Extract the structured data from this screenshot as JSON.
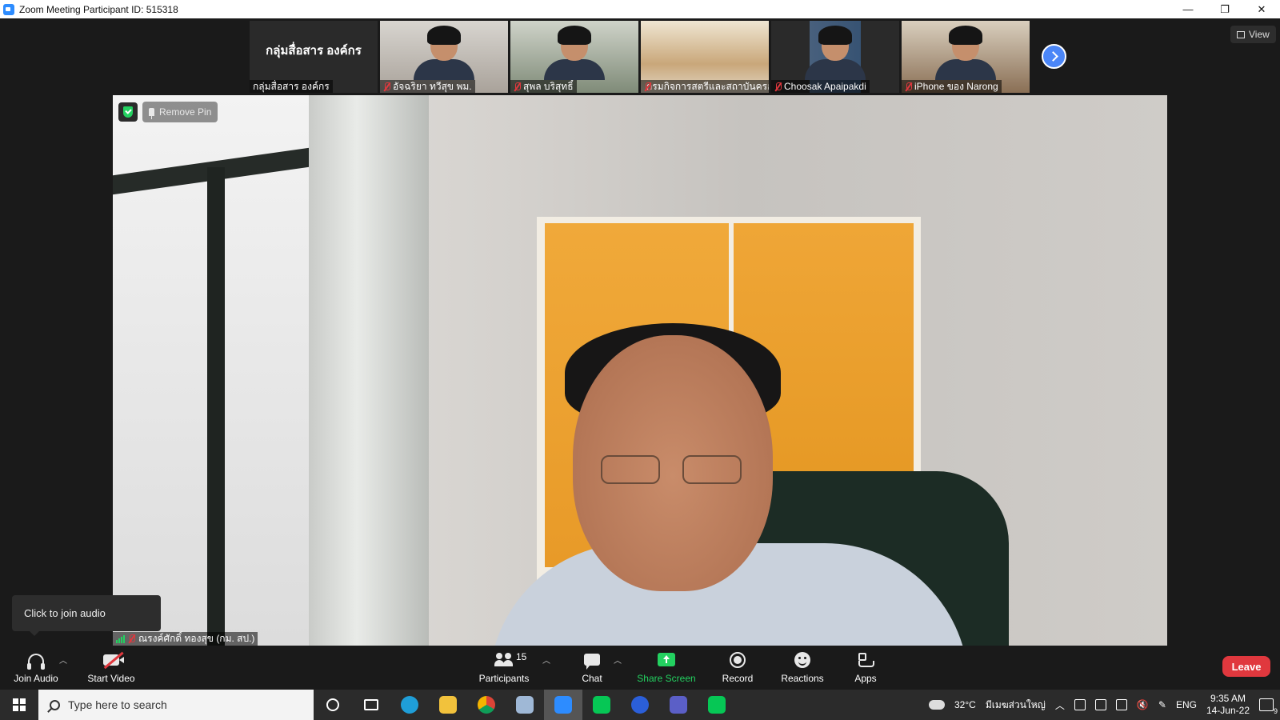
{
  "window": {
    "title": "Zoom Meeting Participant ID: 515318",
    "controls": [
      "—",
      "❐",
      "✕"
    ]
  },
  "gallery": {
    "tiles": [
      {
        "big_name": "กลุ่มสื่อสาร องค์กร",
        "name": "กลุ่มสื่อสาร องค์กร",
        "muted": false
      },
      {
        "name": "อัจฉริยา ทวีสุข พม.",
        "muted": true
      },
      {
        "name": "สุพล บริสุทธิ์",
        "muted": true
      },
      {
        "name": "กรมกิจการสตรีและสถาบันครอ...",
        "muted": true
      },
      {
        "name": "Choosak Apaipakdi",
        "muted": true
      },
      {
        "name": "iPhone ของ Narong",
        "muted": true
      }
    ],
    "next_icon": "chevron-right-icon"
  },
  "view_button": {
    "label": "View"
  },
  "main_video": {
    "remove_pin_label": "Remove Pin",
    "speaker_name": "ณรงค์ศักดิ์ ทองสุข (กม. สป.)"
  },
  "tooltip": {
    "text": "Click to join audio"
  },
  "toolbar": {
    "join_audio": "Join Audio",
    "start_video": "Start Video",
    "participants": "Participants",
    "participants_count": "15",
    "chat": "Chat",
    "share_screen": "Share Screen",
    "record": "Record",
    "reactions": "Reactions",
    "apps": "Apps",
    "leave": "Leave",
    "share_color": "#23d160",
    "leave_color": "#e0383e"
  },
  "taskbar": {
    "search_placeholder": "Type here to search",
    "weather": "32°C",
    "location": "มีเมฆส่วนใหญ่",
    "language": "ENG",
    "time": "9:35 AM",
    "date": "14-Jun-22",
    "notification_count": "9"
  }
}
